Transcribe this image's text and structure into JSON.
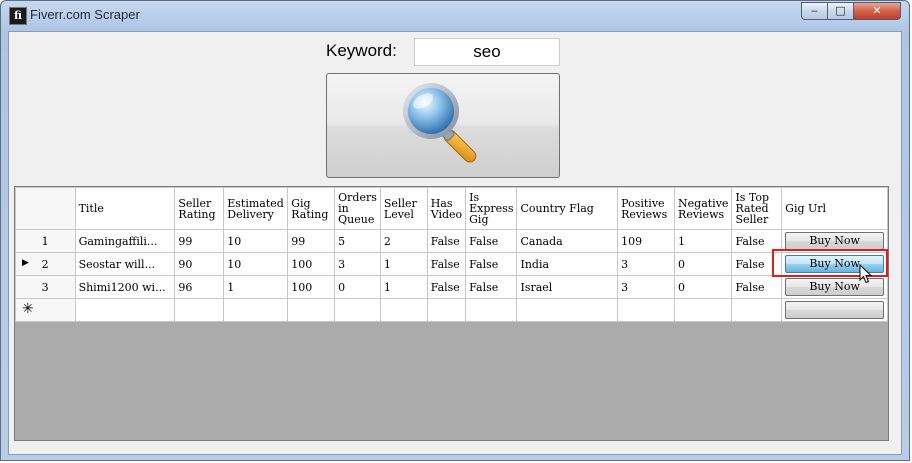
{
  "window": {
    "title": "Fiverr.com Scraper",
    "app_icon_glyph": "fi",
    "controls": {
      "minimize": "‒",
      "maximize": "□",
      "close": "✕"
    }
  },
  "search": {
    "keyword_label": "Keyword:",
    "keyword_value": "seo",
    "search_button_icon": "magnifier-icon"
  },
  "grid": {
    "columns": [
      "Title",
      "Seller Rating",
      "Estimated Delivery",
      "Gig Rating",
      "Orders in Queue",
      "Seller Level",
      "Has Video",
      "Is Express Gig",
      "Country Flag",
      "Positive Reviews",
      "Negative Reviews",
      "Is Top Rated Seller",
      "Gig Url"
    ],
    "rows": [
      {
        "num": "1",
        "title": "Gamingaffili...",
        "seller_rating": "99",
        "delivery": "10",
        "gig_rating": "99",
        "orders_in_queue": "5",
        "seller_level": "2",
        "has_video": "False",
        "is_express": "False",
        "country": "Canada",
        "positive": "109",
        "negative": "1",
        "top_rated": "False",
        "url_button": "Buy Now"
      },
      {
        "num": "2",
        "title": "Seostar will...",
        "seller_rating": "90",
        "delivery": "10",
        "gig_rating": "100",
        "orders_in_queue": "3",
        "seller_level": "1",
        "has_video": "False",
        "is_express": "False",
        "country": "India",
        "positive": "3",
        "negative": "0",
        "top_rated": "False",
        "url_button": "Buy Now"
      },
      {
        "num": "3",
        "title": "Shimi1200 wi...",
        "seller_rating": "96",
        "delivery": "1",
        "gig_rating": "100",
        "orders_in_queue": "0",
        "seller_level": "1",
        "has_video": "False",
        "is_express": "False",
        "country": "Israel",
        "positive": "3",
        "negative": "0",
        "top_rated": "False",
        "url_button": "Buy Now"
      }
    ],
    "current_row_marker": "▶",
    "new_row_marker": "✳"
  },
  "colors": {
    "grid_background": "#ababab",
    "highlight_box": "#e01c1c",
    "hover_button": "#98d1ef"
  }
}
